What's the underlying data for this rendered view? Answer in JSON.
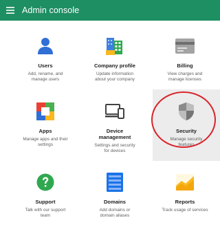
{
  "appbar": {
    "title": "Admin console",
    "menu_icon": "hamburger-menu-icon",
    "background": "#1e8e63"
  },
  "tiles": [
    {
      "title": "Users",
      "description": "Add, rename, and\nmanage users",
      "icon": "person-icon"
    },
    {
      "title": "Company profile",
      "description": "Update information\nabout your company",
      "icon": "company-profile-icon"
    },
    {
      "title": "Billing",
      "description": "View charges and\nmanage licenses",
      "icon": "credit-card-icon"
    },
    {
      "title": "Apps",
      "description": "Manage apps and their\nsettings",
      "icon": "apps-grid-icon"
    },
    {
      "title": "Device\nmanagement",
      "description": "Settings and security\nfor devices",
      "icon": "devices-icon"
    },
    {
      "title": "Security",
      "description": "Manage security\nfeatures",
      "icon": "shield-icon",
      "selected": true
    },
    {
      "title": "Support",
      "description": "Talk with our support\nteam",
      "icon": "help-icon"
    },
    {
      "title": "Domains",
      "description": "Add domains or\ndomain aliases",
      "icon": "domains-icon"
    },
    {
      "title": "Reports",
      "description": "Track usage of services",
      "icon": "reports-chart-icon"
    }
  ],
  "highlight_color": "#d9232a"
}
